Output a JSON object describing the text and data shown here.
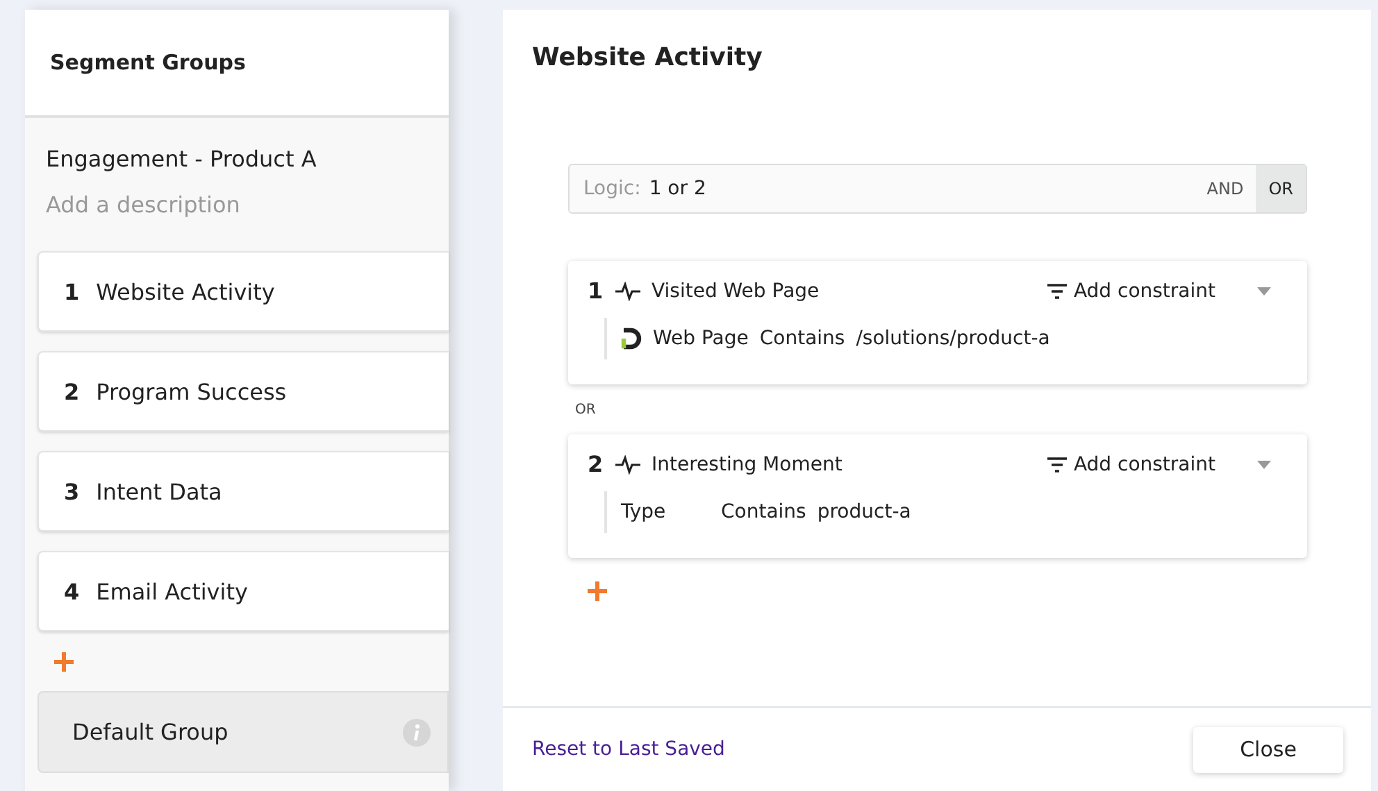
{
  "sidebar": {
    "title": "Segment Groups",
    "segment_name": "Engagement - Product A",
    "description": {
      "placeholder": "Add a description"
    },
    "groups": [
      {
        "number": "1",
        "label": "Website Activity"
      },
      {
        "number": "2",
        "label": "Program Success"
      },
      {
        "number": "3",
        "label": "Intent Data"
      },
      {
        "number": "4",
        "label": "Email Activity"
      }
    ],
    "default_group": {
      "label": "Default Group"
    }
  },
  "dialog": {
    "title": "Website Activity",
    "logic": {
      "label": "Logic:",
      "value": "1 or 2",
      "operators": [
        {
          "label": "AND",
          "selected": false
        },
        {
          "label": "OR",
          "selected": true
        }
      ]
    },
    "filters": [
      {
        "number": "1",
        "name": "Visited Web Page",
        "add_constraint": "Add constraint",
        "condition": {
          "kind": "webpage",
          "field": "Web Page",
          "operator": "Contains",
          "value": "/solutions/product-a"
        }
      },
      {
        "number": "2",
        "name": "Interesting Moment",
        "add_constraint": "Add constraint",
        "condition": {
          "kind": "plain",
          "field": "Type",
          "operator": "Contains",
          "value": "product-a"
        }
      }
    ],
    "joiner": "OR",
    "footer": {
      "reset_link": "Reset to Last Saved",
      "close_button": "Close"
    }
  }
}
